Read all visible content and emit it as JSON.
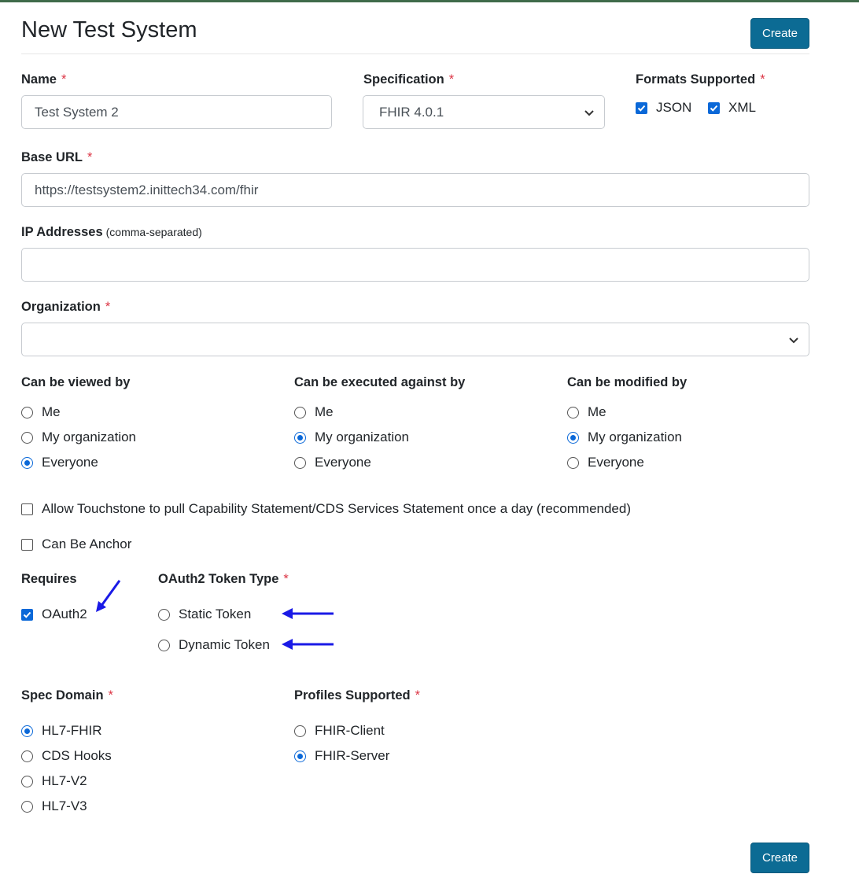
{
  "header": {
    "title": "New Test System",
    "create_label": "Create"
  },
  "footer": {
    "create_label": "Create"
  },
  "required_mark": "*",
  "name": {
    "label": "Name",
    "value": "Test System 2"
  },
  "specification": {
    "label": "Specification",
    "value": "FHIR 4.0.1"
  },
  "formats": {
    "label": "Formats Supported",
    "options": [
      {
        "label": "JSON",
        "checked": true
      },
      {
        "label": "XML",
        "checked": true
      }
    ]
  },
  "base_url": {
    "label": "Base URL",
    "value": "https://testsystem2.inittech34.com/fhir"
  },
  "ip_addresses": {
    "label": "IP Addresses",
    "hint": "(comma-separated)",
    "value": ""
  },
  "organization": {
    "label": "Organization",
    "value": ""
  },
  "viewed_by": {
    "label": "Can be viewed by",
    "options": [
      "Me",
      "My organization",
      "Everyone"
    ],
    "selected": "Everyone"
  },
  "executed_by": {
    "label": "Can be executed against by",
    "options": [
      "Me",
      "My organization",
      "Everyone"
    ],
    "selected": "My organization"
  },
  "modified_by": {
    "label": "Can be modified by",
    "options": [
      "Me",
      "My organization",
      "Everyone"
    ],
    "selected": "My organization"
  },
  "allow_pull": {
    "label": "Allow Touchstone to pull Capability Statement/CDS Services Statement once a day (recommended)",
    "checked": false
  },
  "anchor": {
    "label": "Can Be Anchor",
    "checked": false
  },
  "requires": {
    "label": "Requires",
    "option": "OAuth2",
    "checked": true
  },
  "oauth_token_type": {
    "label": "OAuth2 Token Type",
    "options": [
      "Static Token",
      "Dynamic Token"
    ],
    "selected": ""
  },
  "spec_domain": {
    "label": "Spec Domain",
    "options": [
      "HL7-FHIR",
      "CDS Hooks",
      "HL7-V2",
      "HL7-V3"
    ],
    "selected": "HL7-FHIR"
  },
  "profiles": {
    "label": "Profiles Supported",
    "options": [
      "FHIR-Client",
      "FHIR-Server"
    ],
    "selected": "FHIR-Server"
  },
  "colors": {
    "primary": "#0c6b94",
    "accent": "#0a68d8",
    "required": "#dc3545",
    "annotation_arrow": "#1a1ae6"
  },
  "icons": {
    "select": "chevron-down-icon",
    "annotation": "arrow-icon"
  }
}
